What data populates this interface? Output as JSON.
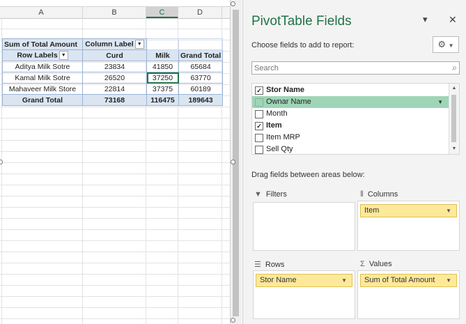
{
  "sheet": {
    "columns": [
      {
        "label": "A",
        "selected": false
      },
      {
        "label": "B",
        "selected": false
      },
      {
        "label": "C",
        "selected": true
      },
      {
        "label": "D",
        "selected": false
      }
    ],
    "pivot": {
      "corner": "Sum of Total Amount",
      "column_labels": "Column Label",
      "row_labels": "Row Labels",
      "headers": [
        "Curd",
        "Milk",
        "Grand Total"
      ],
      "rows": [
        {
          "label": "Aditya Milk Sotre",
          "values": [
            "23834",
            "41850",
            "65684"
          ]
        },
        {
          "label": "Kamal Milk Sotre",
          "values": [
            "26520",
            "37250",
            "63770"
          ]
        },
        {
          "label": "Mahaveer Milk Store",
          "values": [
            "22814",
            "37375",
            "60189"
          ]
        }
      ],
      "total": {
        "label": "Grand Total",
        "values": [
          "73168",
          "116475",
          "189643"
        ]
      },
      "active_cell": "C3"
    }
  },
  "pane": {
    "title": "PivotTable Fields",
    "choose_label": "Choose fields to add to report:",
    "search_placeholder": "Search",
    "fields": [
      {
        "name": "Stor Name",
        "checked": true,
        "bold": true,
        "highlighted": false
      },
      {
        "name": "Ownar Name",
        "checked": false,
        "bold": false,
        "highlighted": true
      },
      {
        "name": "Month",
        "checked": false,
        "bold": false,
        "highlighted": false
      },
      {
        "name": "Item",
        "checked": true,
        "bold": true,
        "highlighted": false
      },
      {
        "name": "Item MRP",
        "checked": false,
        "bold": false,
        "highlighted": false
      },
      {
        "name": "Sell Qty",
        "checked": false,
        "bold": false,
        "highlighted": false
      }
    ],
    "drag_label": "Drag fields between areas below:",
    "areas": {
      "filters": {
        "label": "Filters",
        "items": []
      },
      "columns": {
        "label": "Columns",
        "items": [
          "Item"
        ]
      },
      "rows": {
        "label": "Rows",
        "items": [
          "Stor Name"
        ]
      },
      "values": {
        "label": "Values",
        "items": [
          "Sum of Total Amount"
        ]
      }
    },
    "accent_color": "#217346",
    "chip_color": "#fde99a",
    "highlight_color": "#9fd5b7"
  },
  "icons": {
    "filter": "funnel-icon",
    "columns": "columns-icon",
    "rows": "rows-icon",
    "values": "sigma-icon",
    "settings": "gear-icon",
    "search": "magnifier-icon"
  }
}
